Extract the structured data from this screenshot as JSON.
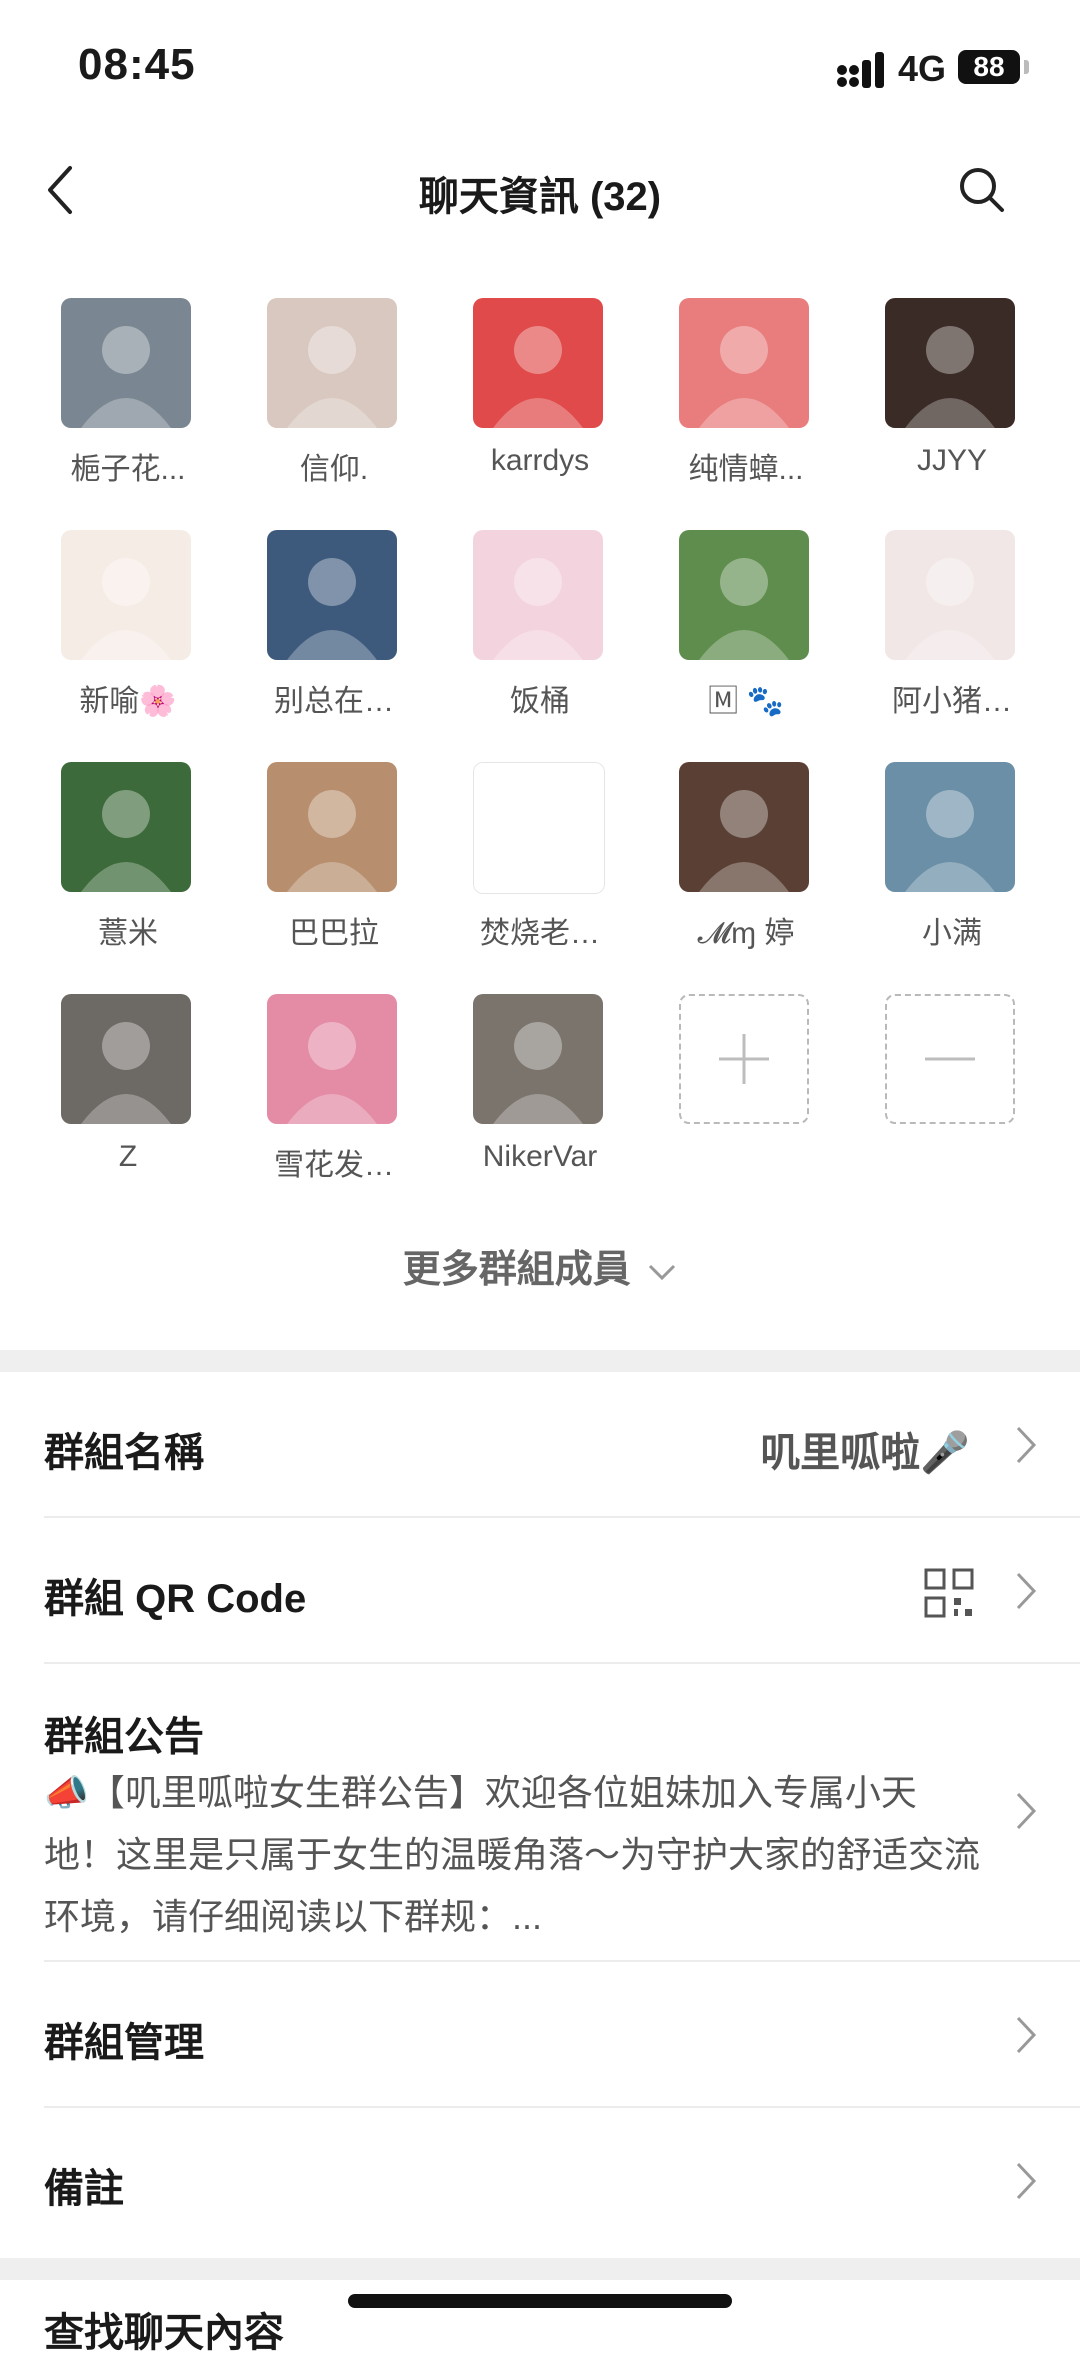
{
  "status_bar": {
    "time": "08:45",
    "network": "4G",
    "battery": "88"
  },
  "nav": {
    "title": "聊天資訊 (32)"
  },
  "members": [
    {
      "name": "梔子花...",
      "color": "#7a8792"
    },
    {
      "name": "信仰.",
      "color": "#d9c8c0"
    },
    {
      "name": "karrdys",
      "color": "#e04a4a"
    },
    {
      "name": "纯情蟑...",
      "color": "#e97d7d"
    },
    {
      "name": "JJYY",
      "color": "#3a2b26"
    },
    {
      "name": "新喻🌸",
      "color": "#f6ece6"
    },
    {
      "name": "别总在…",
      "color": "#3d5a7d"
    },
    {
      "name": "饭桶",
      "color": "#f3d3de"
    },
    {
      "name": "🄼 🐾",
      "color": "#5f8d4d"
    },
    {
      "name": "阿小猪…",
      "color": "#f1e7e6"
    },
    {
      "name": "薏米",
      "color": "#3c6a3a"
    },
    {
      "name": "巴巴拉",
      "color": "#b88f6e"
    },
    {
      "name": "焚烧老…",
      "color": "#ffffff"
    },
    {
      "name": "𝓜ɱ 婷",
      "color": "#5a4034"
    },
    {
      "name": "小满",
      "color": "#6a8fa6"
    },
    {
      "name": "Z",
      "color": "#6d6965"
    },
    {
      "name": "雪花发…",
      "color": "#e48ba6"
    },
    {
      "name": "NikerVar",
      "color": "#7a746c"
    }
  ],
  "more_members": "更多群組成員",
  "rows": {
    "group_name_label": "群組名稱",
    "group_name_value": "叽里呱啦🎤",
    "qr_label": "群組 QR Code",
    "notice_label": "群組公告",
    "notice_text": "📣【叽里呱啦女生群公告】欢迎各位姐妹加入专属小天地！这里是只属于女生的温暖角落～为守护大家的舒适交流环境，请仔细阅读以下群规：...",
    "manage_label": "群組管理",
    "remark_label": "備註",
    "partial_label": "查找聊天內容"
  }
}
